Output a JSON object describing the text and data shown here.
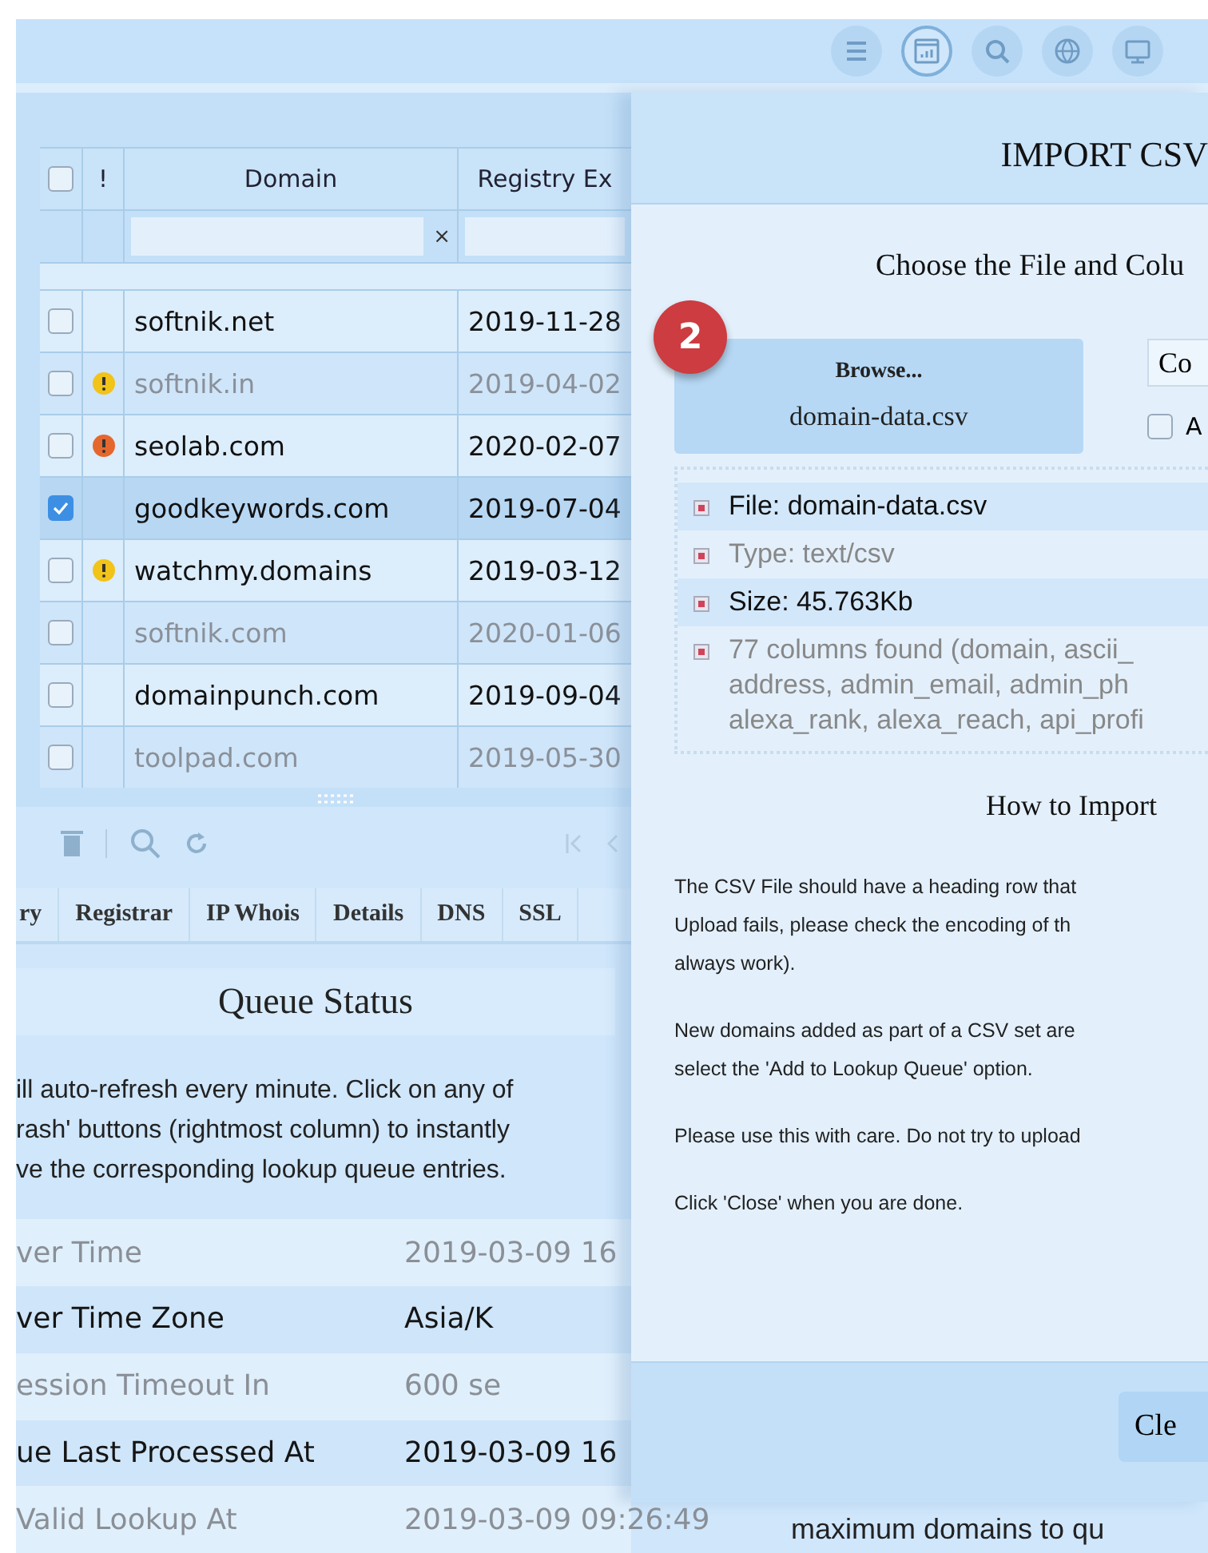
{
  "toolbar": {
    "icons": [
      {
        "kind": "menu",
        "selected": false
      },
      {
        "kind": "dashboard",
        "selected": true
      },
      {
        "kind": "search",
        "selected": false
      },
      {
        "kind": "globe",
        "selected": false
      },
      {
        "kind": "monitor",
        "selected": false
      }
    ]
  },
  "table": {
    "header_checkbox": {
      "checked": false
    },
    "columns": [
      "!",
      "Domain",
      "Registry Ex"
    ],
    "filter": {
      "clear_label": "×"
    },
    "rows": [
      {
        "domain": "softnik.net",
        "registry_expiry": "2019-11-28",
        "checked": false,
        "inactive": false,
        "selected": false
      },
      {
        "domain": "softnik.in",
        "registry_expiry": "2019-04-02",
        "checked": false,
        "alert": {
          "color": "#f2c318"
        },
        "inactive": true,
        "selected": false
      },
      {
        "domain": "seolab.com",
        "registry_expiry": "2020-02-07",
        "checked": false,
        "alert": {
          "color": "#e5672d"
        },
        "inactive": false,
        "selected": false
      },
      {
        "domain": "goodkeywords.com",
        "registry_expiry": "2019-07-04",
        "checked": true,
        "inactive": false,
        "selected": true
      },
      {
        "domain": "watchmy.domains",
        "registry_expiry": "2019-03-12",
        "checked": false,
        "alert": {
          "color": "#f2c318"
        },
        "inactive": false,
        "selected": false
      },
      {
        "domain": "softnik.com",
        "registry_expiry": "2020-01-06",
        "checked": false,
        "inactive": true,
        "selected": false
      },
      {
        "domain": "domainpunch.com",
        "registry_expiry": "2019-09-04",
        "checked": false,
        "inactive": false,
        "selected": false
      },
      {
        "domain": "toolpad.com",
        "registry_expiry": "2019-05-30",
        "checked": false,
        "inactive": true,
        "selected": false
      }
    ]
  },
  "tabs": [
    {
      "label": "ry",
      "selected": false
    },
    {
      "label": "Registrar",
      "selected": false
    },
    {
      "label": "IP Whois",
      "selected": false
    },
    {
      "label": "Details",
      "selected": false
    },
    {
      "label": "DNS",
      "selected": false
    },
    {
      "label": "SSL",
      "selected": false
    }
  ],
  "queue_status": {
    "title": "Queue Status",
    "description": [
      "ill auto-refresh every minute. Click on any of",
      "rash' buttons (rightmost column) to instantly",
      "ve the corresponding lookup queue entries."
    ],
    "rows": [
      {
        "label": "ver Time",
        "value": "2019-03-09 16"
      },
      {
        "label": "ver Time Zone",
        "value": "Asia/K"
      },
      {
        "label": "ession Timeout In",
        "value": "600 se"
      },
      {
        "label": "ue Last Processed At",
        "value": "2019-03-09 16"
      },
      {
        "label": "Valid Lookup At",
        "value": "2019-03-09 09:26:49"
      }
    ]
  },
  "background_text": [
    "maximum domains to qu"
  ],
  "import_dialog": {
    "title": "IMPORT CSV",
    "subtitle": "Choose the File and Colu",
    "step_badge": "2",
    "browse_button": {
      "label": "Browse...",
      "file": "domain-data.csv"
    },
    "side_button": "Co",
    "option": {
      "label": "A",
      "checked": false
    },
    "file_info": [
      {
        "lines": [
          "File: domain-data.csv"
        ]
      },
      {
        "lines": [
          "Type: text/csv"
        ]
      },
      {
        "lines": [
          "Size: 45.763Kb"
        ]
      },
      {
        "lines": [
          "77 columns found (domain, ascii_",
          "address, admin_email, admin_ph",
          "alexa_rank, alexa_reach, api_profi"
        ]
      }
    ],
    "help_title": "How to Import",
    "help_paragraphs": [
      [
        "The CSV File should have a heading row that",
        "Upload fails, please check the encoding of th",
        "always work)."
      ],
      [
        "New domains added as part of a CSV set are",
        "select the 'Add to Lookup Queue' option."
      ],
      [
        "Please use this with care. Do not try to upload"
      ],
      [
        "Click 'Close' when you are done."
      ]
    ],
    "footer_button": "Cle"
  }
}
